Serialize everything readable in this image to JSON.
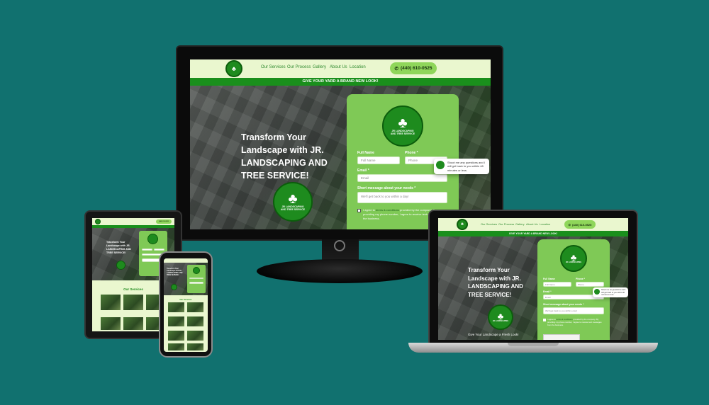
{
  "nav": {
    "links": [
      "Our Services",
      "Our Process",
      "Gallery",
      "About Us",
      "Location"
    ],
    "phone": "(440) 610-0525"
  },
  "logo": {
    "brand_line1": "JR LANDSCAPING",
    "brand_line2": "AND TREE SERVICE"
  },
  "banner": "GIVE YOUR YARD A BRAND NEW LOOK!",
  "hero": {
    "title": "Transform Your Landscape with JR. LANDSCAPING AND TREE SERVICE!",
    "tagline": "Give Your Landscape a Fresh Look!"
  },
  "form": {
    "full_name_label": "Full Name",
    "full_name_placeholder": "Full Name",
    "phone_label": "Phone *",
    "phone_placeholder": "Phone",
    "email_label": "Email *",
    "email_placeholder": "Email",
    "message_label": "Short message about your needs *",
    "message_placeholder": "We'll get back to you within a day!",
    "consent_prefix": "I agree to ",
    "consent_link": "terms & conditions",
    "consent_rest": " provided by the company. By providing my phone number, I agree to receive text messages from the business."
  },
  "chat": {
    "message": "Shoot me any questions and I will get back to you within 48 minutes or less."
  },
  "services": {
    "title": "Our Services"
  },
  "colors": {
    "background": "#11716f",
    "brand_green": "#1e8b1e",
    "light_green": "#7fc956",
    "nav_bg": "#eaf7cf"
  }
}
